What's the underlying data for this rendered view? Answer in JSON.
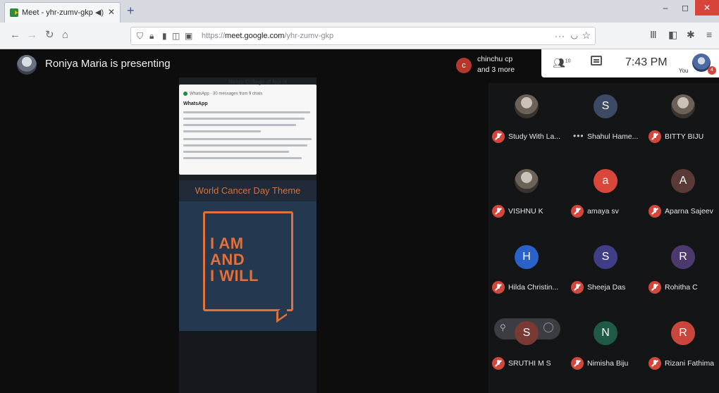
{
  "browser": {
    "tab_title": "Meet - yhr-zumv-gkp",
    "tab_mute_icon": "speaker-icon",
    "tab_close": "✕",
    "new_tab": "+",
    "window_controls": [
      "–",
      "◻",
      "✕"
    ],
    "url_prefix": "https://",
    "url_host": "meet.google.com",
    "url_path": "/yhr-zumv-gkp",
    "page_actions": "···"
  },
  "meeting": {
    "presenter_text": "Roniya Maria is presenting",
    "chat_preview": {
      "initial": "c",
      "line1": "chinchu cp",
      "line2": "and 3 more"
    },
    "people_count": "10",
    "time": "7:43 PM",
    "self_label": "You",
    "notification_count": "4"
  },
  "slide": {
    "header": "Nehru College of Nul ol",
    "chat_meta": "WhatsApp · 30 messages from 9 chats",
    "chat_name": "WhatsApp",
    "theme_title": "World Cancer Day Theme",
    "poster_lines": [
      "I AM",
      "AND",
      "I WILL"
    ]
  },
  "participants": [
    {
      "name": "Study With La...",
      "initial": "",
      "photo": true,
      "color": "",
      "muted": true
    },
    {
      "name": "Shahul Hame...",
      "initial": "S",
      "photo": false,
      "color": "#3d4a66",
      "muted": false
    },
    {
      "name": "BITTY BIJU",
      "initial": "",
      "photo": true,
      "color": "",
      "muted": true
    },
    {
      "name": "VISHNU K",
      "initial": "",
      "photo": true,
      "color": "",
      "muted": true
    },
    {
      "name": "amaya sv",
      "initial": "a",
      "photo": false,
      "color": "#d9473b",
      "muted": true
    },
    {
      "name": "Aparna Sajeev",
      "initial": "A",
      "photo": false,
      "color": "#5a3a36",
      "muted": true
    },
    {
      "name": "Hilda Christin...",
      "initial": "H",
      "photo": false,
      "color": "#2a62c9",
      "muted": true
    },
    {
      "name": "Sheeja Das",
      "initial": "S",
      "photo": false,
      "color": "#3f3e86",
      "muted": true
    },
    {
      "name": "Rohitha C",
      "initial": "R",
      "photo": false,
      "color": "#4c3a6e",
      "muted": true
    },
    {
      "name": "SRUTHI M S",
      "initial": "S",
      "photo": false,
      "color": "#7a3a34",
      "muted": true
    },
    {
      "name": "Nimisha Biju",
      "initial": "N",
      "photo": false,
      "color": "#1e5a46",
      "muted": true
    },
    {
      "name": "Rizani Fathima",
      "initial": "R",
      "photo": false,
      "color": "#c8463b",
      "muted": true
    }
  ]
}
